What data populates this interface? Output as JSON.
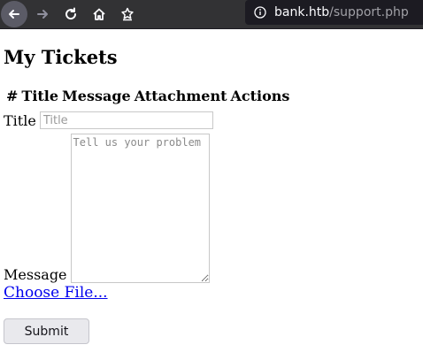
{
  "browser": {
    "url_host": "bank.htb",
    "url_path": "/support.php",
    "icons": [
      "back-icon",
      "forward-icon",
      "reload-icon",
      "home-icon",
      "bookmark-icon",
      "info-icon"
    ]
  },
  "page": {
    "title": "My Tickets",
    "table_headers": [
      "#",
      "Title",
      "Message",
      "Attachment",
      "Actions"
    ],
    "form": {
      "title_label": "Title",
      "title_placeholder": "Title",
      "message_label": "Message",
      "message_placeholder": "Tell us your problem",
      "file_link": "Choose File...",
      "submit_label": "Submit"
    }
  }
}
